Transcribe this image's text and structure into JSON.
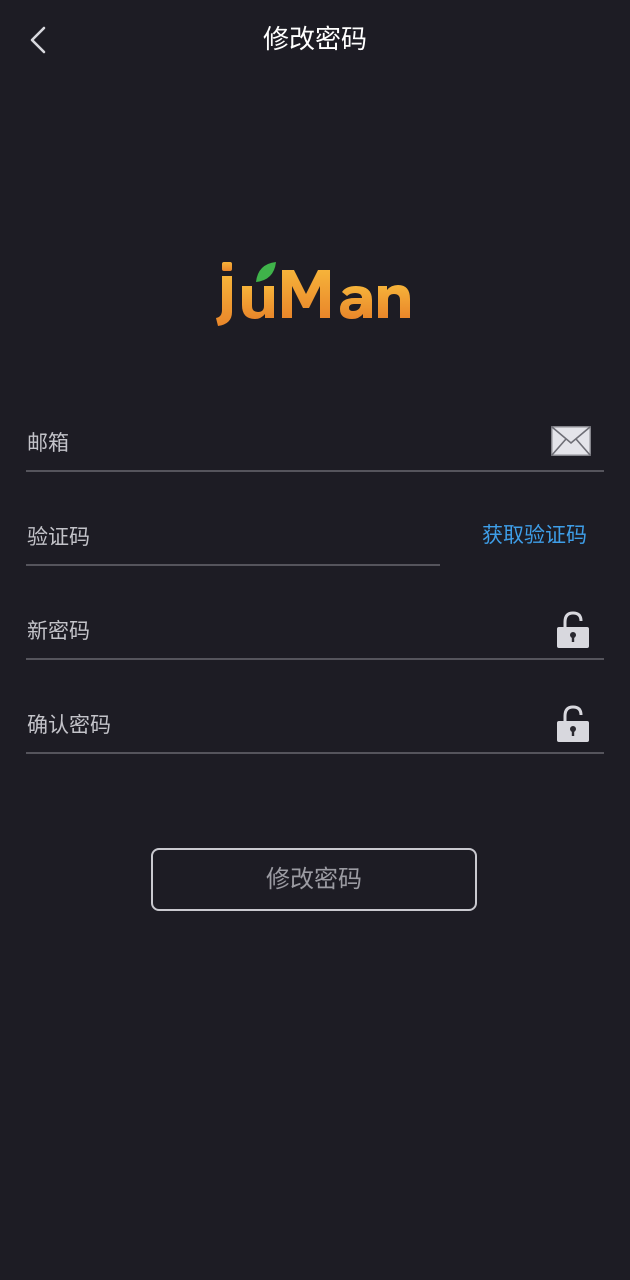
{
  "header": {
    "title": "修改密码",
    "back_icon": "chevron-left-icon"
  },
  "logo": {
    "text": "juMan"
  },
  "form": {
    "email": {
      "label": "邮箱",
      "icon": "mail-icon"
    },
    "code": {
      "label": "验证码",
      "action": "获取验证码"
    },
    "new_password": {
      "label": "新密码",
      "icon": "lock-icon"
    },
    "confirm_password": {
      "label": "确认密码",
      "icon": "lock-icon"
    },
    "submit": "修改密码"
  },
  "colors": {
    "background": "#1d1c24",
    "link": "#3e9ee8",
    "logo_orange": "#f0a52b",
    "logo_green": "#3fb34a"
  }
}
